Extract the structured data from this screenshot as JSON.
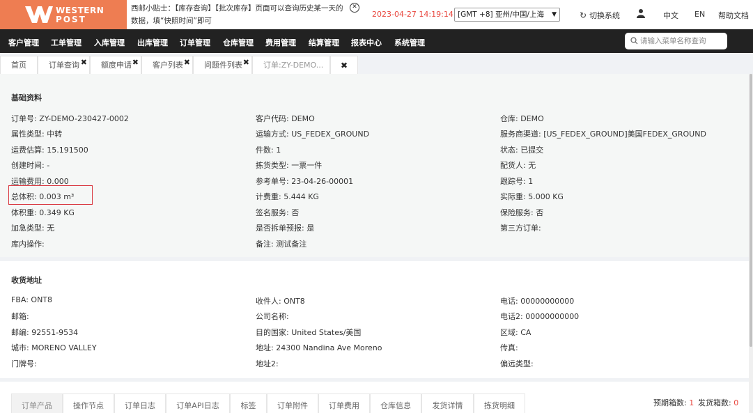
{
  "brand": {
    "name_line1": "WESTERN",
    "name_line2": "POST",
    "color": "#ee7d52"
  },
  "tip": {
    "text": "西邮小贴士：【库存查询】【批次库存】页面可以查询历史某一天的数据，填“快照时间”即可"
  },
  "datetime": "2023-04-27 14:19:14",
  "timezone": "[GMT +8] 亚州/中国/上海",
  "switch_system": "切换系统",
  "lang_zh": "中文",
  "lang_en": "EN",
  "help": "帮助文档",
  "nav": [
    "客户管理",
    "工单管理",
    "入库管理",
    "出库管理",
    "订单管理",
    "仓库管理",
    "费用管理",
    "结算管理",
    "报表中心",
    "系统管理"
  ],
  "menu_search": {
    "placeholder": "请输入菜单名称查询"
  },
  "tabs": [
    {
      "label": "首页"
    },
    {
      "label": "订单查询"
    },
    {
      "label": "额度申请"
    },
    {
      "label": "客户列表"
    },
    {
      "label": "问题件列表"
    },
    {
      "label": "订单:ZY-DEMO..."
    }
  ],
  "basic": {
    "title": "基础资料",
    "col1": [
      "订单号: ZY-DEMO-230427-0002",
      "属性类型: 中转",
      "运费估算: 15.191500",
      "创建时间: -",
      "运输费用: 0.000",
      "总体积: 0.003 m³",
      "体积重: 0.349 KG",
      "加急类型: 无",
      "库内操作:"
    ],
    "col2": [
      "客户代码: DEMO",
      "运输方式: US_FEDEX_GROUND",
      "件数: 1",
      "拣货类型: 一票一件",
      "参考单号: 23-04-26-00001",
      "计费重: 5.444 KG",
      "签名服务: 否",
      "是否拆单预报: 是",
      "备注:   测试备注"
    ],
    "col3": [
      "仓库: DEMO",
      "服务商渠道: [US_FEDEX_GROUND]美国FEDEX_GROUND",
      "状态: 已提交",
      "配货人: 无",
      "跟踪号: 1",
      "实际重: 5.000 KG",
      "保险服务: 否",
      "第三方订单:"
    ]
  },
  "address": {
    "title": "收货地址",
    "col1": [
      "FBA: ONT8",
      "邮箱:",
      "邮编: 92551-9534",
      "城市: MORENO VALLEY",
      "门牌号:"
    ],
    "col2": [
      "收件人: ONT8",
      "公司名称:",
      "目的国家: United States/美国",
      "地址: 24300 Nandina Ave    Moreno",
      "地址2:"
    ],
    "col3": [
      "电话: 00000000000",
      "电话2: 00000000000",
      "区域: CA",
      "传真:",
      "偏远类型:"
    ]
  },
  "bottom_tabs": [
    "订单产品",
    "操作节点",
    "订单日志",
    "订单API日志",
    "标签",
    "订单附件",
    "订单费用",
    "仓库信息",
    "发货详情",
    "拣货明细"
  ],
  "bottom_right": {
    "label1": "预期箱数:",
    "value1": "1",
    "label2": "发货箱数:",
    "value2": "0"
  }
}
